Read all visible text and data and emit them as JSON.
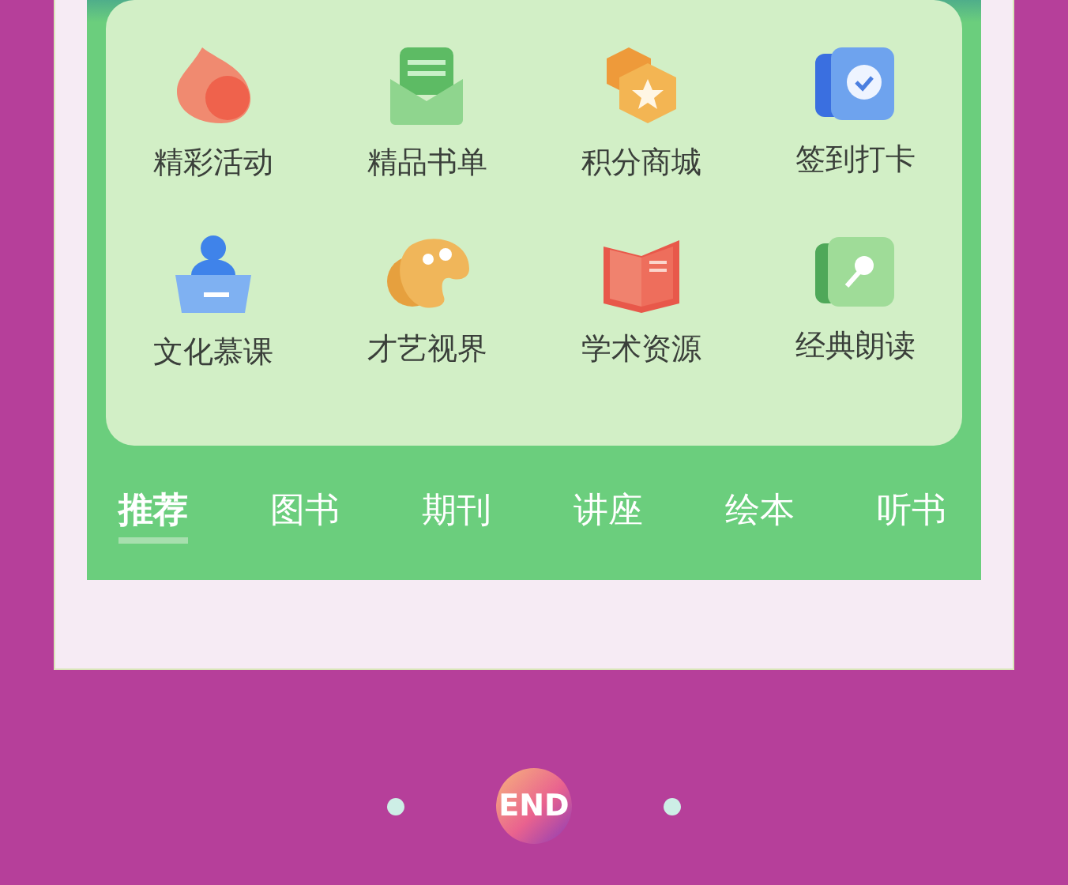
{
  "shortcuts": [
    {
      "label": "精彩活动"
    },
    {
      "label": "精品书单"
    },
    {
      "label": "积分商城"
    },
    {
      "label": "签到打卡"
    },
    {
      "label": "文化慕课"
    },
    {
      "label": "才艺视界"
    },
    {
      "label": "学术资源"
    },
    {
      "label": "经典朗读"
    }
  ],
  "tabs": [
    {
      "label": "推荐",
      "selected": true
    },
    {
      "label": "图书",
      "selected": false
    },
    {
      "label": "期刊",
      "selected": false
    },
    {
      "label": "讲座",
      "selected": false
    },
    {
      "label": "绘本",
      "selected": false
    },
    {
      "label": "听书",
      "selected": false
    }
  ],
  "end_marker": {
    "label": "END"
  }
}
